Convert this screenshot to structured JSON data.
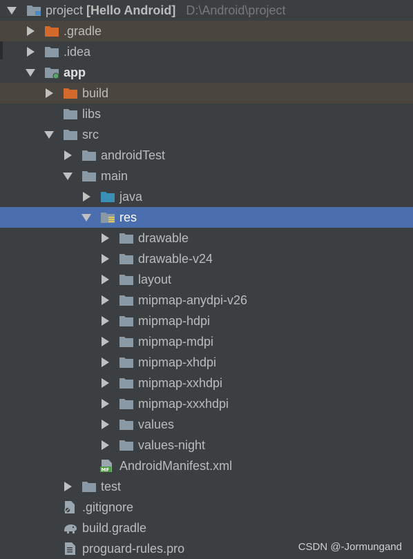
{
  "header": {
    "project_name": "project",
    "project_title": "[Hello Android]",
    "project_path": "D:\\Android\\project"
  },
  "tree": {
    "gradle_dir": ".gradle",
    "idea_dir": ".idea",
    "app_module": "app",
    "build_dir": "build",
    "libs_dir": "libs",
    "src_dir": "src",
    "android_test_dir": "androidTest",
    "main_dir": "main",
    "java_dir": "java",
    "res_dir": "res",
    "res_children": [
      "drawable",
      "drawable-v24",
      "layout",
      "mipmap-anydpi-v26",
      "mipmap-hdpi",
      "mipmap-mdpi",
      "mipmap-xhdpi",
      "mipmap-xxhdpi",
      "mipmap-xxxhdpi",
      "values",
      "values-night"
    ],
    "manifest_file": "AndroidManifest.xml",
    "test_dir": "test",
    "gitignore_file": ".gitignore",
    "build_gradle_file": "build.gradle",
    "proguard_file": "proguard-rules.pro"
  },
  "watermark": "CSDN @-Jormungand",
  "colors": {
    "background": "#3c3f41",
    "selection": "#4b6eaf",
    "excluded_folder": "#d4692c",
    "folder": "#8a99a6",
    "source_folder": "#3a8fb7",
    "manifest_badge": "#4d9e43"
  },
  "icons": {
    "module": "module-folder-icon",
    "excluded": "excluded-folder-icon",
    "folder": "folder-icon",
    "source": "source-folder-icon",
    "resources": "resources-folder-icon",
    "manifest": "manifest-file-icon",
    "ignore": "gitignore-file-icon",
    "gradle": "gradle-elephant-icon",
    "text": "text-file-icon"
  }
}
